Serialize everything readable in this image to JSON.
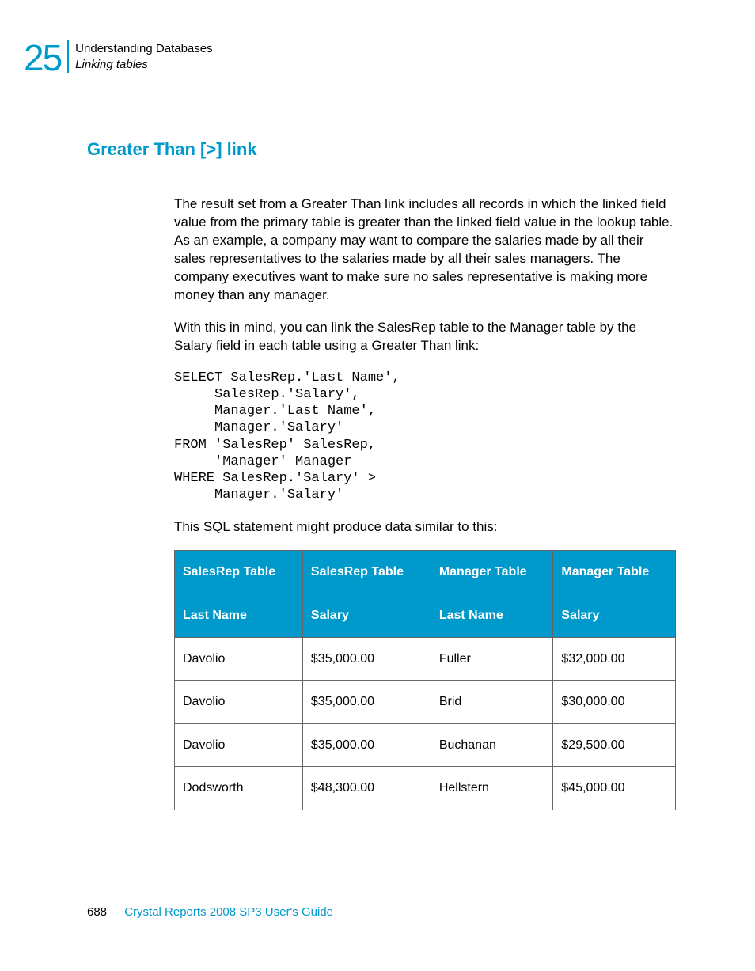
{
  "header": {
    "chapter_number": "25",
    "chapter_title": "Understanding Databases",
    "section_title": "Linking tables"
  },
  "section": {
    "heading": "Greater Than [>] link",
    "para1": "The result set from a Greater Than link includes all records in which the linked field value from the primary table is greater than the linked field value in the lookup table. As an example, a company may want to compare the salaries made by all their sales representatives to the salaries made by all their sales managers. The company executives want to make sure no sales representative is making more money than any manager.",
    "para2": "With this in mind, you can link the SalesRep table to the Manager table by the Salary field in each table using a Greater Than link:",
    "code": "SELECT SalesRep.'Last Name',\n     SalesRep.'Salary',\n     Manager.'Last Name',\n     Manager.'Salary'\nFROM 'SalesRep' SalesRep,\n     'Manager' Manager\nWHERE SalesRep.'Salary' >\n     Manager.'Salary'",
    "para3": "This SQL statement might produce data similar to this:"
  },
  "table": {
    "header_row1": [
      "SalesRep Table",
      "SalesRep Table",
      "Manager Table",
      "Manager Table"
    ],
    "header_row2": [
      "Last Name",
      "Salary",
      "Last Name",
      "Salary"
    ],
    "rows": [
      [
        "Davolio",
        "$35,000.00",
        "Fuller",
        "$32,000.00"
      ],
      [
        "Davolio",
        "$35,000.00",
        "Brid",
        "$30,000.00"
      ],
      [
        "Davolio",
        "$35,000.00",
        "Buchanan",
        "$29,500.00"
      ],
      [
        "Dodsworth",
        "$48,300.00",
        "Hellstern",
        "$45,000.00"
      ]
    ]
  },
  "footer": {
    "page_number": "688",
    "doc_title": "Crystal Reports 2008 SP3 User's Guide"
  }
}
